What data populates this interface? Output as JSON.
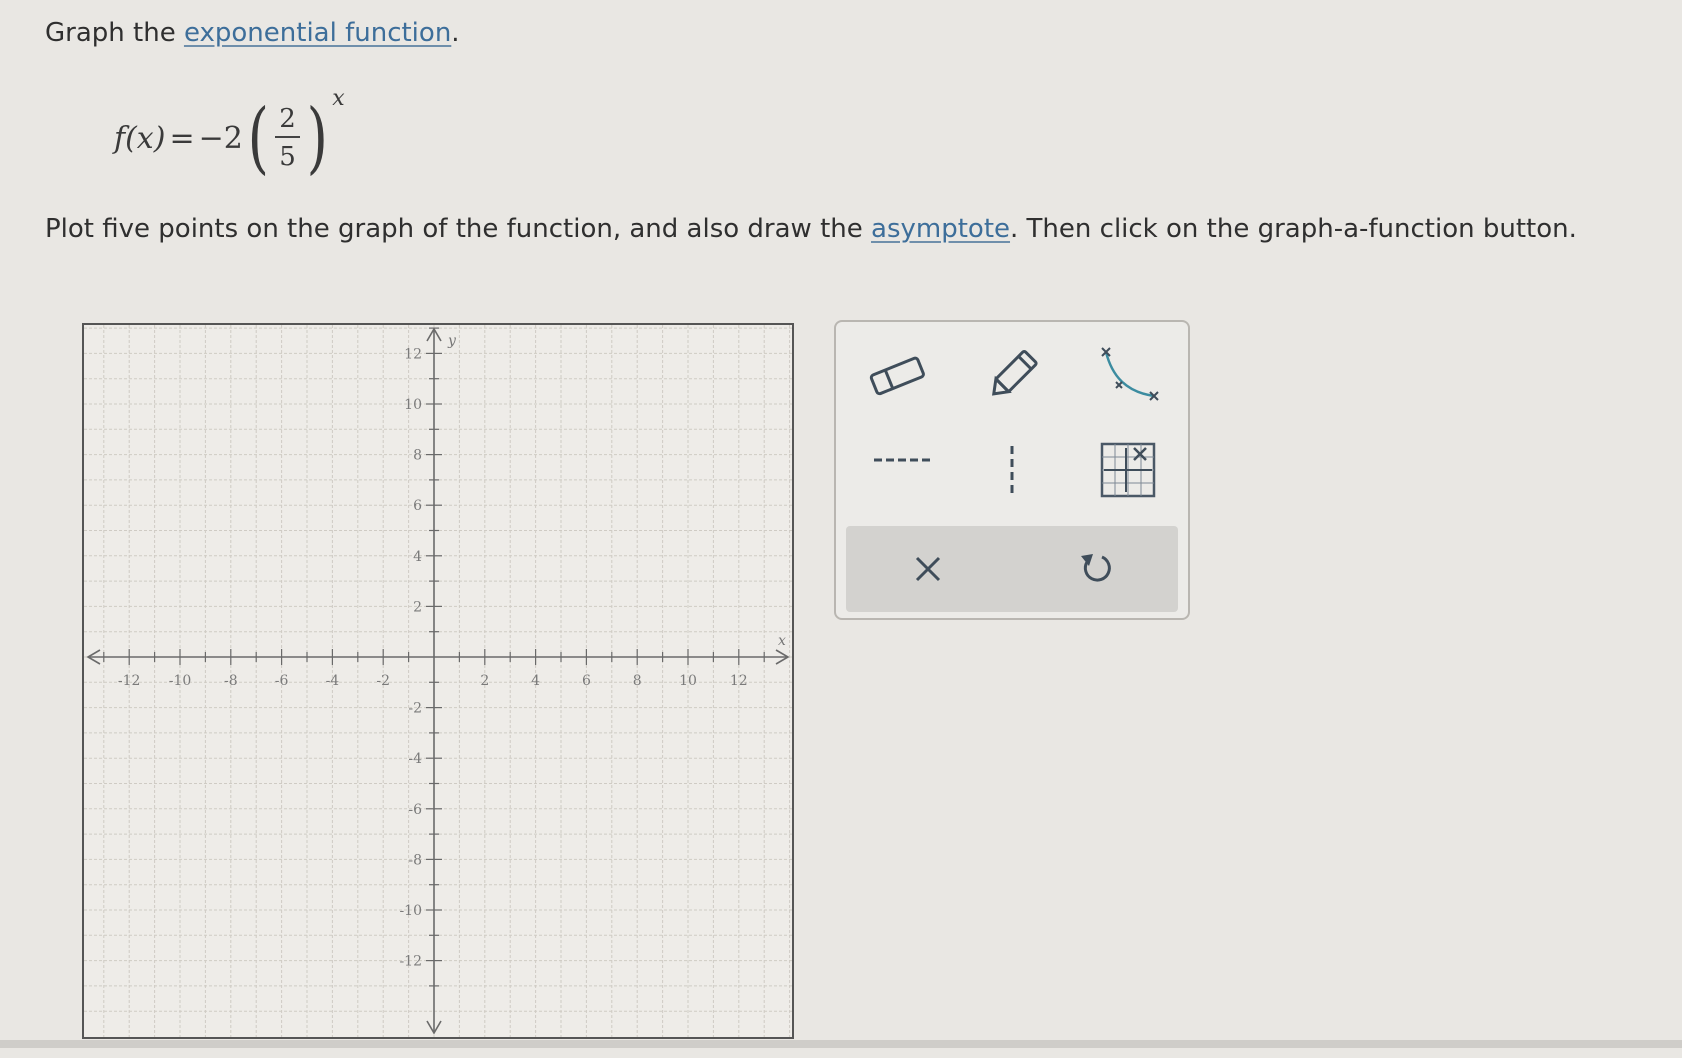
{
  "prompt": {
    "lead": "Graph the ",
    "link": "exponential function",
    "trail": "."
  },
  "formula": {
    "lhs": "f(x)",
    "equals": "=",
    "coefficient": "−2",
    "numerator": "2",
    "denominator": "5",
    "exponent": "x"
  },
  "instruction": {
    "lead": "Plot five points on the graph of the function, and also draw the ",
    "link": "asymptote",
    "trail": ". Then click on the graph-a-function button."
  },
  "chart_data": {
    "type": "scatter",
    "xlim": [
      -14,
      14
    ],
    "ylim": [
      -14,
      14
    ],
    "xlabel": "x",
    "ylabel": "y",
    "x_ticks": [
      "-12",
      "-10",
      "-8",
      "-6",
      "-4",
      "-2",
      "2",
      "4",
      "6",
      "8",
      "10",
      "12"
    ],
    "y_ticks": [
      "12",
      "10",
      "8",
      "6",
      "4",
      "2",
      "-2",
      "-4",
      "-6",
      "-8",
      "-10",
      "-12"
    ],
    "grid": true,
    "series": []
  },
  "toolbar": {
    "tools": [
      {
        "name": "eraser-tool",
        "icon": "eraser-icon"
      },
      {
        "name": "pencil-tool",
        "icon": "pencil-icon"
      },
      {
        "name": "exponential-curve-tool",
        "icon": "exponential-curve-icon"
      },
      {
        "name": "horizontal-asymptote-tool",
        "icon": "horizontal-dashed-line-icon"
      },
      {
        "name": "vertical-asymptote-tool",
        "icon": "vertical-dashed-line-icon"
      },
      {
        "name": "graph-a-function-tool",
        "icon": "graph-function-icon"
      }
    ],
    "actions": {
      "clear": {
        "symbol": "×",
        "icon": "close-icon"
      },
      "undo": {
        "icon": "undo-icon"
      }
    }
  },
  "colors": {
    "link": "#3d6e9a",
    "icon": "#4f6f8c",
    "accent": "#3c8ca0"
  }
}
